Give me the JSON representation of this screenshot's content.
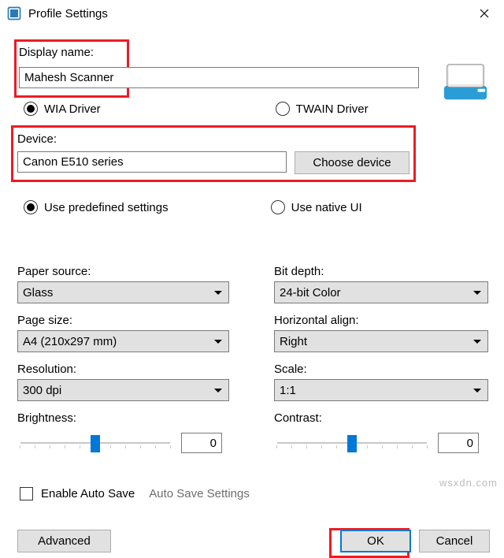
{
  "window": {
    "title": "Profile Settings"
  },
  "name_section": {
    "label": "Display name:",
    "value": "Mahesh Scanner"
  },
  "driver": {
    "wia": "WIA Driver",
    "twain": "TWAIN Driver"
  },
  "device_section": {
    "label": "Device:",
    "value": "Canon E510 series",
    "choose": "Choose device"
  },
  "settings_mode": {
    "predefined": "Use predefined settings",
    "native": "Use native UI"
  },
  "left": {
    "paper_source": {
      "label": "Paper source:",
      "value": "Glass"
    },
    "page_size": {
      "label": "Page size:",
      "value": "A4 (210x297 mm)"
    },
    "resolution": {
      "label": "Resolution:",
      "value": "300 dpi"
    },
    "brightness": {
      "label": "Brightness:",
      "value": "0"
    }
  },
  "right": {
    "bit_depth": {
      "label": "Bit depth:",
      "value": "24-bit Color"
    },
    "h_align": {
      "label": "Horizontal align:",
      "value": "Right"
    },
    "scale": {
      "label": "Scale:",
      "value": "1:1"
    },
    "contrast": {
      "label": "Contrast:",
      "value": "0"
    }
  },
  "autosave": {
    "checkbox": "Enable Auto Save",
    "link": "Auto Save Settings"
  },
  "buttons": {
    "advanced": "Advanced",
    "ok": "OK",
    "cancel": "Cancel"
  },
  "watermark": "wsxdn.com"
}
